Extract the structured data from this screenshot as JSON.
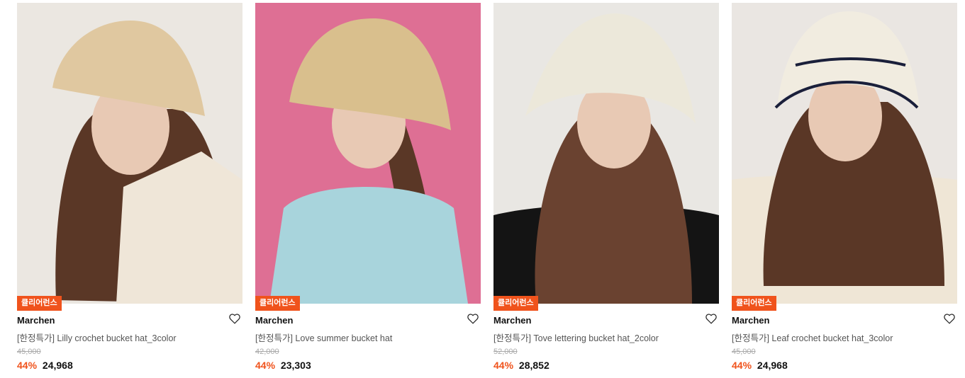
{
  "products": [
    {
      "badge": "큘리어런스",
      "brand": "Marchen",
      "title": "[한정특가] Lilly crochet bucket hat_3color",
      "original_price": "45,000",
      "discount": "44%",
      "price": "24,968",
      "photo": {
        "bg": "#ebe7e1",
        "hat": "#e0c8a0",
        "top": "#efe6d8"
      }
    },
    {
      "badge": "큘리어런스",
      "brand": "Marchen",
      "title": "[한정특가] Love summer bucket hat",
      "original_price": "42,000",
      "discount": "44%",
      "price": "23,303",
      "photo": {
        "bg": "#de6f94",
        "hat": "#d9bf8d",
        "top": "#a8d4dc"
      }
    },
    {
      "badge": "큘리어런스",
      "brand": "Marchen",
      "title": "[한정특가] Tove lettering bucket hat_2color",
      "original_price": "52,000",
      "discount": "44%",
      "price": "28,852",
      "photo": {
        "bg": "#e9e7e3",
        "hat": "#ece8da",
        "top": "#141414"
      }
    },
    {
      "badge": "큘리어런스",
      "brand": "Marchen",
      "title": "[한정특가] Leaf crochet bucket hat_3color",
      "original_price": "45,000",
      "discount": "44%",
      "price": "24,968",
      "photo": {
        "bg": "#eae6e2",
        "hat": "#f1ece0",
        "top": "#efe6d6"
      }
    }
  ]
}
